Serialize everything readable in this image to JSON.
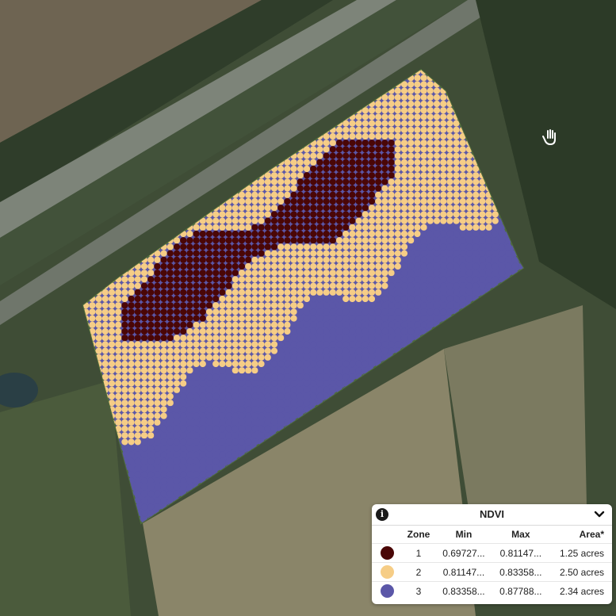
{
  "legend": {
    "title": "NDVI",
    "info_icon": "info-icon",
    "collapse_icon": "chevron-down-icon",
    "columns": [
      "",
      "Zone",
      "Min",
      "Max",
      "Area*"
    ],
    "rows": [
      {
        "zone": "1",
        "min": "0.69727...",
        "max": "0.81147...",
        "area": "1.25 acres",
        "color": "#4a0606"
      },
      {
        "zone": "2",
        "min": "0.81147...",
        "max": "0.83358...",
        "area": "2.50 acres",
        "color": "#f6cd86"
      },
      {
        "zone": "3",
        "min": "0.83358...",
        "max": "0.87788...",
        "area": "2.34 acres",
        "color": "#5b57a8"
      }
    ]
  },
  "cursor": "hand-cursor-icon"
}
